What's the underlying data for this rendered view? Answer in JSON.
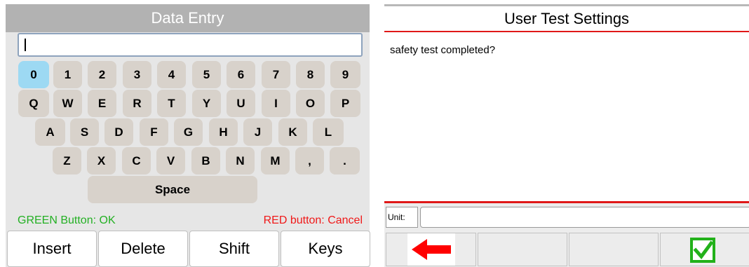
{
  "data_entry": {
    "title": "Data Entry",
    "field_value": "",
    "keyboard": {
      "row1": [
        "0",
        "1",
        "2",
        "3",
        "4",
        "5",
        "6",
        "7",
        "8",
        "9"
      ],
      "row2": [
        "Q",
        "W",
        "E",
        "R",
        "T",
        "Y",
        "U",
        "I",
        "O",
        "P"
      ],
      "row3": [
        "A",
        "S",
        "D",
        "F",
        "G",
        "H",
        "J",
        "K",
        "L"
      ],
      "row4": [
        "Z",
        "X",
        "C",
        "V",
        "B",
        "N",
        "M",
        ",",
        "."
      ],
      "space": "Space"
    },
    "hint_ok": "GREEN Button: OK",
    "hint_cancel": "RED button: Cancel",
    "soft_keys": [
      "Insert",
      "Delete",
      "Shift",
      "Keys"
    ],
    "colors": {
      "ok_hint": "#23b023",
      "cancel_hint": "#f01818",
      "selected_key": "#9dd9f3"
    }
  },
  "user_test_settings": {
    "title": "User Test Settings",
    "question": "safety test completed?",
    "unit_label": "Unit:",
    "unit_value": "",
    "bottom_buttons": [
      "back-arrow-icon",
      "",
      "",
      "check-box-icon"
    ],
    "colors": {
      "accent": "#e01818",
      "check": "#22b11a"
    }
  }
}
